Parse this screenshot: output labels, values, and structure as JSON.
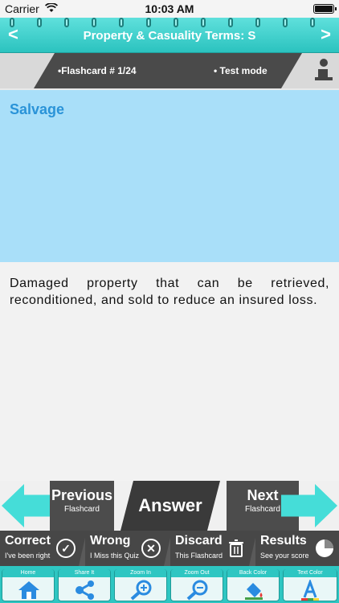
{
  "status": {
    "carrier": "Carrier",
    "time": "10:03 AM"
  },
  "header": {
    "prev": "<",
    "title": "Property & Casuality Terms: S",
    "next": ">"
  },
  "info": {
    "card_no": "•Flashcard #  1/24",
    "mode": "• Test mode"
  },
  "card": {
    "term": "Salvage",
    "definition": "Damaged property that can be retrieved, reconditioned, and sold to reduce an insured loss."
  },
  "controls": {
    "previous": {
      "label": "Previous",
      "sub": "Flashcard"
    },
    "answer": {
      "label": "Answer"
    },
    "next": {
      "label": "Next",
      "sub": "Flashcard"
    }
  },
  "scoring": [
    {
      "label": "Correct",
      "sub": "I've been right",
      "icon": "check-icon"
    },
    {
      "label": "Wrong",
      "sub": "I Miss this Quiz",
      "icon": "cross-icon"
    },
    {
      "label": "Discard",
      "sub": "This Flashcard",
      "icon": "trash-icon"
    },
    {
      "label": "Results",
      "sub": "See your score",
      "icon": "pie-chart-icon"
    }
  ],
  "tools": [
    {
      "label": "Home",
      "icon": "home-icon"
    },
    {
      "label": "Share It",
      "icon": "share-icon"
    },
    {
      "label": "Zoom In",
      "icon": "zoom-in-icon"
    },
    {
      "label": "Zoom Out",
      "icon": "zoom-out-icon"
    },
    {
      "label": "Back Color",
      "icon": "paint-bucket-icon"
    },
    {
      "label": "Text Color",
      "icon": "text-color-icon"
    }
  ],
  "colors": {
    "accent": "#2ec6c2",
    "term_bg": "#a9dff9",
    "term_text": "#2a93d8",
    "dark": "#4a4a4a"
  }
}
